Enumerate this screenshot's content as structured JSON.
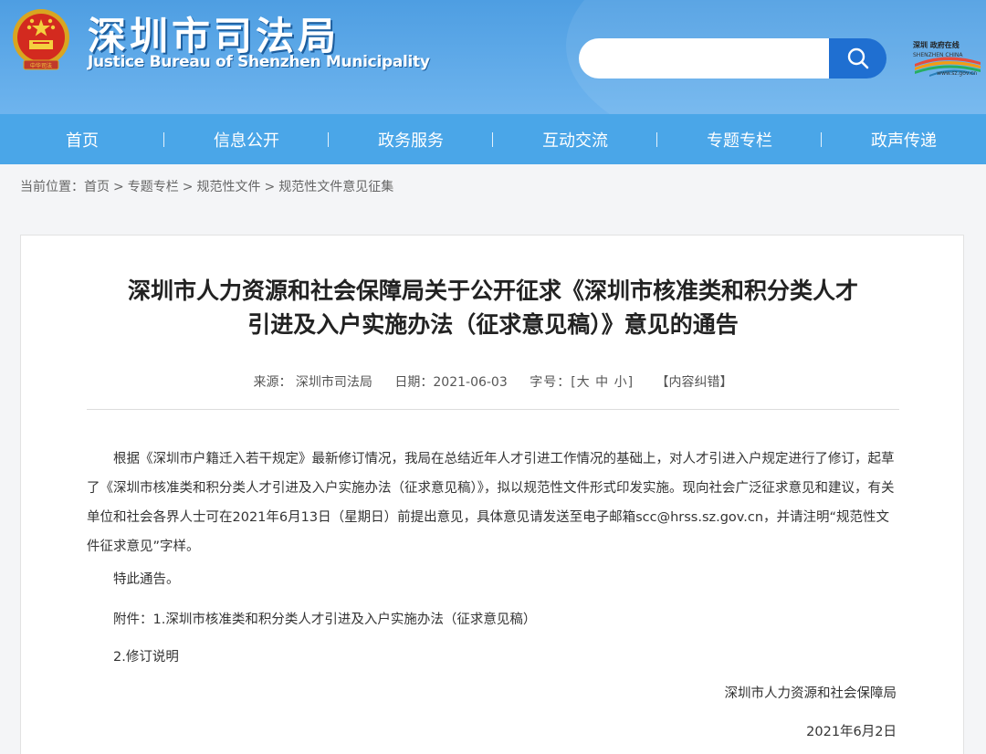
{
  "header": {
    "title": "深圳市司法局",
    "subtitle": "Justice Bureau of Shenzhen Municipality",
    "search_placeholder": "",
    "sz_logo_text": "深圳 政府在线",
    "sz_logo_sub": "SHENZHEN CHINA",
    "sz_logo_url": "www.sz.gov.cn"
  },
  "nav": {
    "items": [
      {
        "label": "首页"
      },
      {
        "label": "信息公开"
      },
      {
        "label": "政务服务"
      },
      {
        "label": "互动交流"
      },
      {
        "label": "专题专栏"
      },
      {
        "label": "政声传递"
      }
    ]
  },
  "breadcrumb": {
    "prefix": "当前位置：",
    "items": [
      "首页",
      "专题专栏",
      "规范性文件",
      "规范性文件意见征集"
    ],
    "separator": ">"
  },
  "article": {
    "title_line1": "深圳市人力资源和社会保障局关于公开征求《深圳市核准类和积分类人才",
    "title_line2": "引进及入户实施办法（征求意见稿）》意见的通告",
    "source": "来源： 深圳市司法局",
    "date": "日期：2021-06-03",
    "font_size_label": "字号：[大 中 小]",
    "correction": "【内容纠错】",
    "body": "根据《深圳市户籍迁入若干规定》最新修订情况，我局在总结近年人才引进工作情况的基础上，对人才引进入户规定进行了修订，起草了《深圳市核准类和积分类人才引进及入户实施办法（征求意见稿）》，拟以规范性文件形式印发实施。现向社会广泛征求意见和建议，有关单位和社会各界人士可在2021年6月13日（星期日）前提出意见，具体意见请发送至电子邮箱scc@hrss.sz.gov.cn，并请注明“规范性文件征求意见”字样。",
    "notice": "特此通告。",
    "attachment1": "附件：1.深圳市核准类和积分类人才引进及入户实施办法（征求意见稿）",
    "attachment2": "2.修订说明",
    "signature": "深圳市人力资源和社会保障局",
    "sign_date": "2021年6月2日"
  },
  "colors": {
    "header_bg": "#4e9ee2",
    "nav_bg": "#4aa6e8",
    "search_button": "#1f6fd1"
  }
}
